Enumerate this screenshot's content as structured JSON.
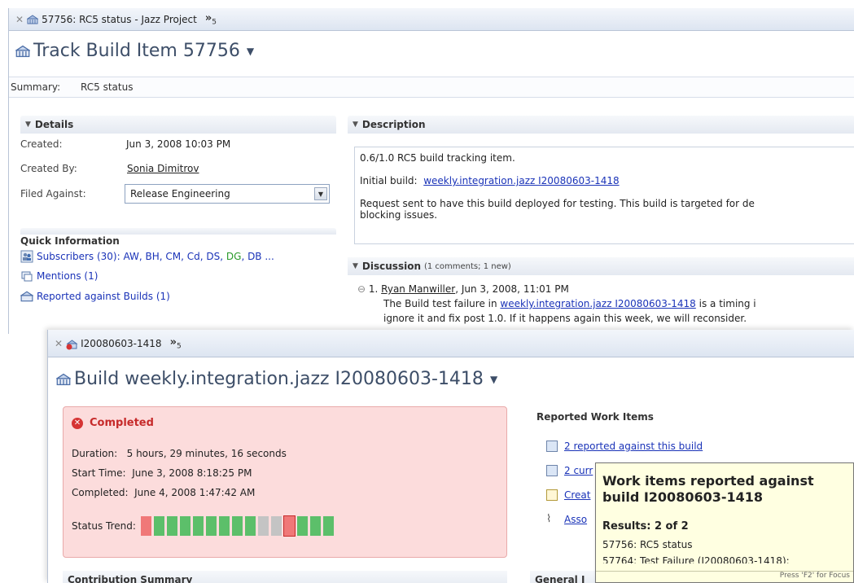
{
  "window1": {
    "tab_title": "57756: RC5 status - Jazz Project",
    "overflow_label": "»",
    "overflow_count": "5",
    "heading": "Track Build Item 57756",
    "summary_label": "Summary:",
    "summary_value": "RC5 status",
    "details": {
      "header": "Details",
      "created_label": "Created:",
      "created_value": "Jun 3, 2008 10:03 PM",
      "created_by_label": "Created By:",
      "created_by_value": "Sonia Dimitrov",
      "filed_against_label": "Filed Against:",
      "filed_against_value": "Release Engineering"
    },
    "quick_info": {
      "title": "Quick Information",
      "subscribers_prefix": "Subscribers (30):",
      "subscribers_names": "AW, BH, CM, Cd, DS,",
      "subscribers_green": "DG",
      "subscribers_rest": ", DB ...",
      "mentions": "Mentions (1)",
      "reported": "Reported against Builds (1)"
    },
    "description": {
      "header": "Description",
      "line1": "0.6/1.0 RC5 build tracking item.",
      "initial_label": "Initial build:",
      "initial_link": "weekly.integration.jazz I20080603-1418",
      "line3a": "Request sent to have this build deployed for testing.  This build is targeted for de",
      "line3b": "blocking issues."
    },
    "discussion": {
      "header": "Discussion",
      "meta": "(1 comments; 1 new)",
      "num": "1.",
      "author": "Ryan Manwiller",
      "date": ", Jun 3, 2008, 11:01 PM",
      "text_a": "The Build test failure in",
      "text_link": "weekly.integration.jazz I20080603-1418",
      "text_b": "is a timing i",
      "text_c": "ignore it and fix post 1.0. If it happens again this week, we will reconsider."
    }
  },
  "window2": {
    "tab_title": "I20080603-1418",
    "overflow_label": "»",
    "overflow_count": "5",
    "heading": "Build weekly.integration.jazz I20080603-1418",
    "status": {
      "title": "Completed",
      "duration_label": "Duration:",
      "duration_value": "5 hours, 29 minutes, 16 seconds",
      "start_label": "Start Time:",
      "start_value": "June 3, 2008 8:18:25 PM",
      "completed_label": "Completed:",
      "completed_value": "June 4, 2008 1:47:42 AM",
      "trend_label": "Status Trend:"
    },
    "contribution_header": "Contribution Summary",
    "reported": {
      "header": "Reported Work Items",
      "link1": "2 reported against this build",
      "link2": "2 curr",
      "link3": "Creat",
      "link4": "Asso"
    },
    "general_header": "General I"
  },
  "tooltip": {
    "title": "Work items reported against build I20080603-1418",
    "results": "Results: 2 of 2",
    "item1": "57756: RC5 status",
    "item2": "57764: Test Failure (I20080603-1418):",
    "footer": "Press 'F2' for Focus"
  },
  "colors": {
    "link": "#1a33b8",
    "error": "#c62a2a",
    "fail_bar": "#f07878",
    "pass_bar": "#5cbf6a",
    "unknown_bar": "#c4c4c4"
  },
  "trend": [
    "fail",
    "pass",
    "pass",
    "pass",
    "pass",
    "pass",
    "pass",
    "pass",
    "pass",
    "unknown",
    "unknown",
    "fail",
    "pass",
    "pass",
    "pass"
  ]
}
